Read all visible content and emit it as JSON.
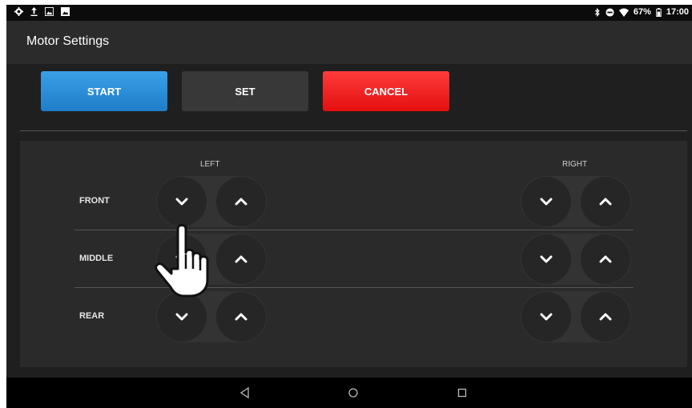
{
  "status_bar": {
    "battery": "67%",
    "time": "17:00",
    "left_icons": [
      "settings-icon",
      "upload-icon",
      "image-icon",
      "gallery-icon"
    ],
    "right_icons": [
      "bluetooth-icon",
      "do-not-disturb-icon",
      "wifi-icon",
      "battery-icon"
    ]
  },
  "app_bar": {
    "title": "Motor Settings"
  },
  "actions": {
    "start": "START",
    "set": "SET",
    "cancel": "CANCEL"
  },
  "columns": {
    "left": "LEFT",
    "right": "RIGHT"
  },
  "rows": [
    {
      "label": "FRONT"
    },
    {
      "label": "MIDDLE"
    },
    {
      "label": "REAR"
    }
  ],
  "colors": {
    "start": "#2b8fdc",
    "cancel": "#f21d1d",
    "set": "#383838",
    "background": "#1f1f1f"
  },
  "nav_bar": {
    "buttons": [
      "back-icon",
      "home-icon",
      "recents-icon"
    ]
  }
}
